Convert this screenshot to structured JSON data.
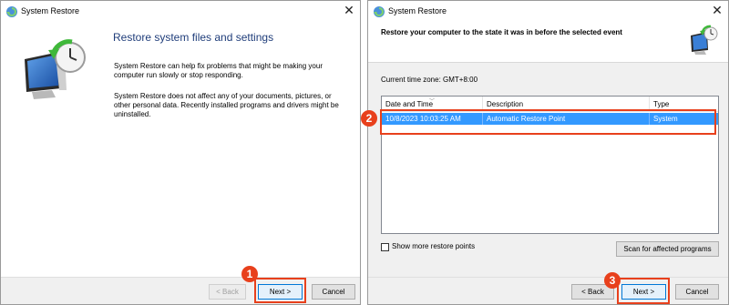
{
  "window1": {
    "title": "System Restore",
    "close_glyph": "✕",
    "heading": "Restore system files and settings",
    "paragraph1": "System Restore can help fix problems that might be making your computer run slowly or stop responding.",
    "paragraph2": "System Restore does not affect any of your documents, pictures, or other personal data. Recently installed programs and drivers might be uninstalled.",
    "buttons": {
      "back": "< Back",
      "next": "Next >",
      "cancel": "Cancel"
    },
    "callout_number": "1",
    "icon": "system-restore-icon"
  },
  "window2": {
    "title": "System Restore",
    "close_glyph": "✕",
    "heading": "Restore your computer to the state it was in before the selected event",
    "timezone": "Current time zone: GMT+8:00",
    "columns": [
      "Date and Time",
      "Description",
      "Type"
    ],
    "rows": [
      {
        "date": "10/8/2023 10:03:25 AM",
        "description": "Automatic Restore Point",
        "type": "System",
        "selected": true
      }
    ],
    "show_more_label": "Show more restore points",
    "show_more_checked": false,
    "scan_button": "Scan for affected programs",
    "buttons": {
      "back": "< Back",
      "next": "Next >",
      "cancel": "Cancel"
    },
    "callout_row_number": "2",
    "callout_next_number": "3",
    "icon": "system-restore-icon"
  },
  "colors": {
    "highlight": "#e8401c",
    "selection": "#3399ff",
    "heading_blue": "#1f3d7a"
  }
}
